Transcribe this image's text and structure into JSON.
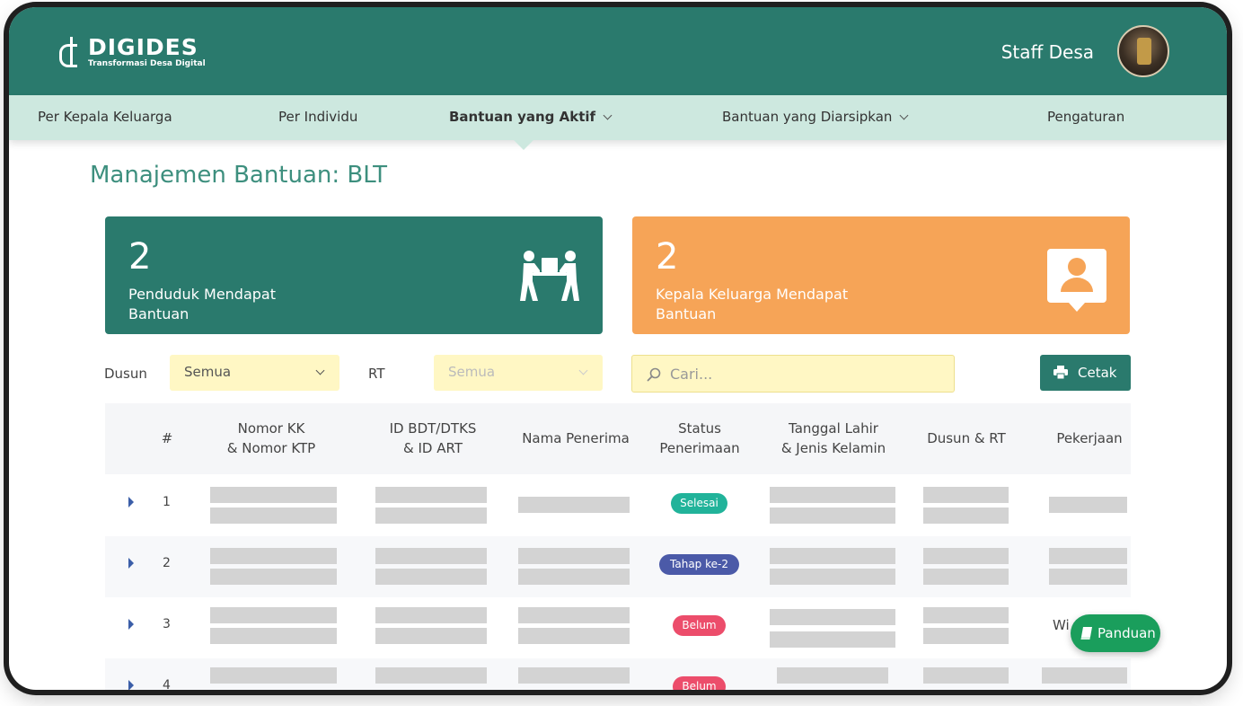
{
  "header": {
    "brand": "DIGIDES",
    "tagline": "Transformasi Desa Digital",
    "user_name": "Staff Desa"
  },
  "nav": {
    "items": [
      {
        "label": "Per Kepala Keluarga"
      },
      {
        "label": "Per Individu"
      },
      {
        "label": "Bantuan yang Aktif"
      },
      {
        "label": "Bantuan yang Diarsipkan"
      },
      {
        "label": "Pengaturan"
      }
    ]
  },
  "page": {
    "title": "Manajemen Bantuan: BLT"
  },
  "stats": [
    {
      "value": "2",
      "label": "Penduduk Mendapat Bantuan",
      "icon": "people-carrying-box-icon",
      "color": "#2a7a6d"
    },
    {
      "value": "2",
      "label": "Kepala Keluarga Mendapat Bantuan",
      "icon": "user-id-card-icon",
      "color": "#f6a457"
    }
  ],
  "filters": {
    "dusun_label": "Dusun",
    "dusun_value": "Semua",
    "rt_label": "RT",
    "rt_value": "Semua",
    "search_placeholder": "Cari...",
    "print_label": "Cetak"
  },
  "table": {
    "headers": [
      "#",
      "Nomor KK\n& Nomor KTP",
      "ID BDT/DTKS\n& ID ART",
      "Nama Penerima",
      "Status\nPenerimaan",
      "Tanggal Lahir\n& Jenis Kelamin",
      "Dusun & RT",
      "Pekerjaan"
    ],
    "rows": [
      {
        "num": "1",
        "status": "Selesai"
      },
      {
        "num": "2",
        "status": "Tahap ke-2"
      },
      {
        "num": "3",
        "status": "Belum",
        "pekerjaan_peek": "Wi"
      },
      {
        "num": "4",
        "status": "Belum"
      }
    ]
  },
  "help_button": {
    "label": "Panduan"
  },
  "colors": {
    "primary": "#2a7a6d",
    "nav_bg": "#cde8df",
    "accent_orange": "#f6a457",
    "filter_bg": "#fff7c4",
    "status_selesai": "#21b39a",
    "status_tahap": "#4b5aa8",
    "status_belum": "#ec4d6b",
    "help_green": "#1a9e5c"
  }
}
